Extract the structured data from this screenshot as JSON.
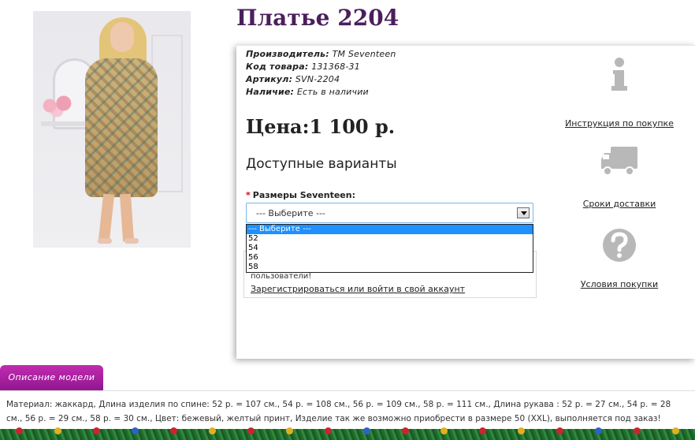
{
  "product": {
    "title": "Платье 2204",
    "image_alt": "Платье 2204"
  },
  "meta": {
    "manufacturer_label": "Производитель:",
    "manufacturer_value": "TM Seventeen",
    "code_label": "Код товара:",
    "code_value": "131368-31",
    "article_label": "Артикул:",
    "article_value": "SVN-2204",
    "availability_label": "Наличие:",
    "availability_value": "Есть в наличии"
  },
  "price": {
    "text": "Цена:1 100 р."
  },
  "variants": {
    "heading": "Доступные варианты",
    "size_label": "Размеры Seventeen:",
    "required_mark": "*",
    "selected_value": "--- Выберите ---",
    "options": [
      "--- Выберите ---",
      "52",
      "54",
      "56",
      "58"
    ]
  },
  "register": {
    "text_partial": "пользователи!",
    "link": "Зарегистрироваться или войти в свой аккаунт"
  },
  "side_links": {
    "instruction": "Инструкция по покупке",
    "delivery": "Сроки доставки",
    "conditions": "Условия покупки"
  },
  "description": {
    "tab_label": "Описание модели",
    "text": "Материал: жаккард, Длина изделия по спине: 52 р. = 107 см., 54 р. = 108 см., 56 р. = 109 см., 58 р. = 111 см., Длина рукава : 52 р. = 27 см., 54 р. = 28 см., 56 р. = 29 см., 58 р. = 30 см., Цвет: бежевый, желтый принт, Изделие так же возможно приобрести в размере 50 (XXL), выполняется под заказ!"
  },
  "colors": {
    "title": "#4a1f5c",
    "tab_gradient_top": "#c22bb0",
    "tab_gradient_bottom": "#8f1890",
    "dropdown_selected": "#1e90ff",
    "icon_gray": "#b8b8b8"
  },
  "icons": {
    "instruction": "info-icon",
    "delivery": "truck-icon",
    "conditions": "question-icon",
    "dropdown": "chevron-down-icon"
  }
}
